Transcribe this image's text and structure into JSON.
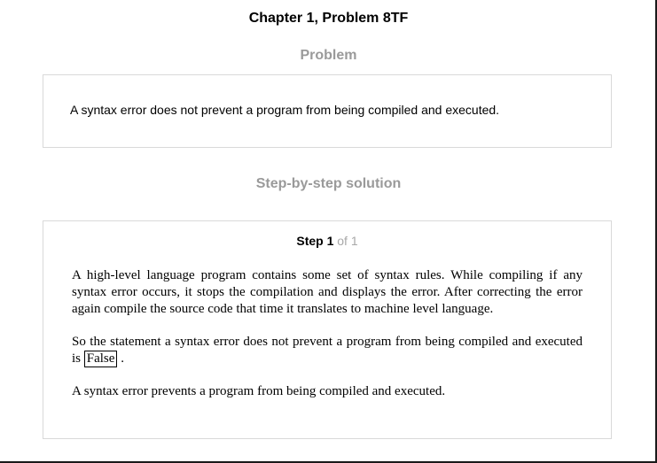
{
  "header": {
    "chapter_title": "Chapter 1, Problem 8TF"
  },
  "problem": {
    "heading": "Problem",
    "text": "A syntax error does not prevent a program from being compiled and executed."
  },
  "solution": {
    "heading": "Step-by-step solution",
    "step_label": "Step 1",
    "step_of": " of 1",
    "paragraph_1": "A high-level language program contains some set of syntax rules. While compiling if any syntax error occurs, it stops the compilation and displays the error. After correcting the error again compile the source code that time it translates to machine level language.",
    "paragraph_2_prefix": "So the statement a syntax error does not prevent a program from being compiled and executed is ",
    "answer": "False",
    "paragraph_2_suffix": " .",
    "paragraph_3": "A syntax error prevents a program from being compiled and executed."
  }
}
